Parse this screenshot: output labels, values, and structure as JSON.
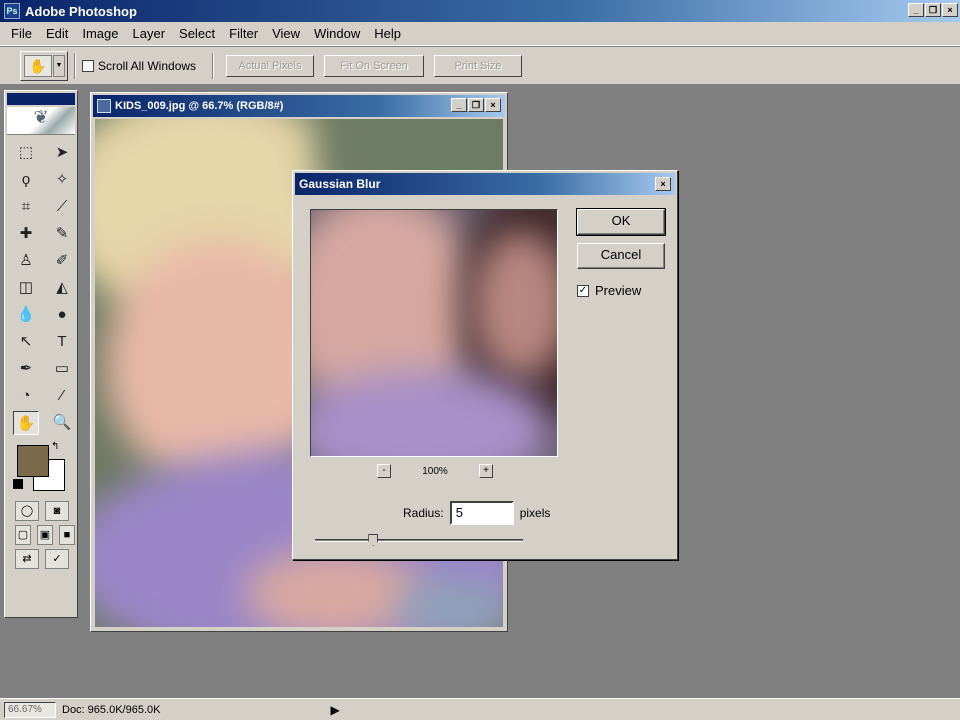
{
  "app": {
    "title": "Adobe Photoshop",
    "icon": "photoshop-icon",
    "window_controls": [
      "_",
      "❐",
      "×"
    ]
  },
  "menu": [
    "File",
    "Edit",
    "Image",
    "Layer",
    "Select",
    "Filter",
    "View",
    "Window",
    "Help"
  ],
  "options_bar": {
    "tool_icon": "hand-tool-icon",
    "scroll_all_windows": "Scroll All Windows",
    "actual_pixels": "Actual Pixels",
    "fit_on_screen": "Fit On Screen",
    "print_size": "Print Size"
  },
  "toolbox": {
    "tools": [
      {
        "name": "marquee-tool-icon",
        "glyph": "⬚"
      },
      {
        "name": "move-tool-icon",
        "glyph": "➤"
      },
      {
        "name": "lasso-tool-icon",
        "glyph": "ϙ"
      },
      {
        "name": "magic-wand-tool-icon",
        "glyph": "✧"
      },
      {
        "name": "crop-tool-icon",
        "glyph": "⌗"
      },
      {
        "name": "slice-tool-icon",
        "glyph": "⟋"
      },
      {
        "name": "healing-brush-tool-icon",
        "glyph": "✚"
      },
      {
        "name": "brush-tool-icon",
        "glyph": "✎"
      },
      {
        "name": "clone-stamp-tool-icon",
        "glyph": "♙"
      },
      {
        "name": "history-brush-tool-icon",
        "glyph": "✐"
      },
      {
        "name": "eraser-tool-icon",
        "glyph": "◫"
      },
      {
        "name": "paint-bucket-tool-icon",
        "glyph": "◭"
      },
      {
        "name": "blur-tool-icon",
        "glyph": "💧"
      },
      {
        "name": "dodge-tool-icon",
        "glyph": "●"
      },
      {
        "name": "path-selection-tool-icon",
        "glyph": "↖"
      },
      {
        "name": "type-tool-icon",
        "glyph": "T"
      },
      {
        "name": "pen-tool-icon",
        "glyph": "✒"
      },
      {
        "name": "rectangle-tool-icon",
        "glyph": "▭"
      },
      {
        "name": "notes-tool-icon",
        "glyph": "◔"
      },
      {
        "name": "eyedropper-tool-icon",
        "glyph": "⁄"
      },
      {
        "name": "hand-tool-icon",
        "glyph": "✋"
      },
      {
        "name": "zoom-tool-icon",
        "glyph": "🔍"
      }
    ],
    "foreground_color": "#7a6a4a",
    "background_color": "#ffffff"
  },
  "document": {
    "title": "KIDS_009.jpg @ 66.7% (RGB/8#)"
  },
  "dialog": {
    "title": "Gaussian Blur",
    "ok": "OK",
    "cancel": "Cancel",
    "preview_label": "Preview",
    "preview_checked": true,
    "zoom_value": "100%",
    "zoom_out": "-",
    "zoom_in": "+",
    "radius_label": "Radius:",
    "radius_value": "5",
    "radius_unit": "pixels",
    "radius_slider_fraction": 0.28
  },
  "status": {
    "zoom": "66.67%",
    "doc": "Doc: 965.0K/965.0K"
  }
}
